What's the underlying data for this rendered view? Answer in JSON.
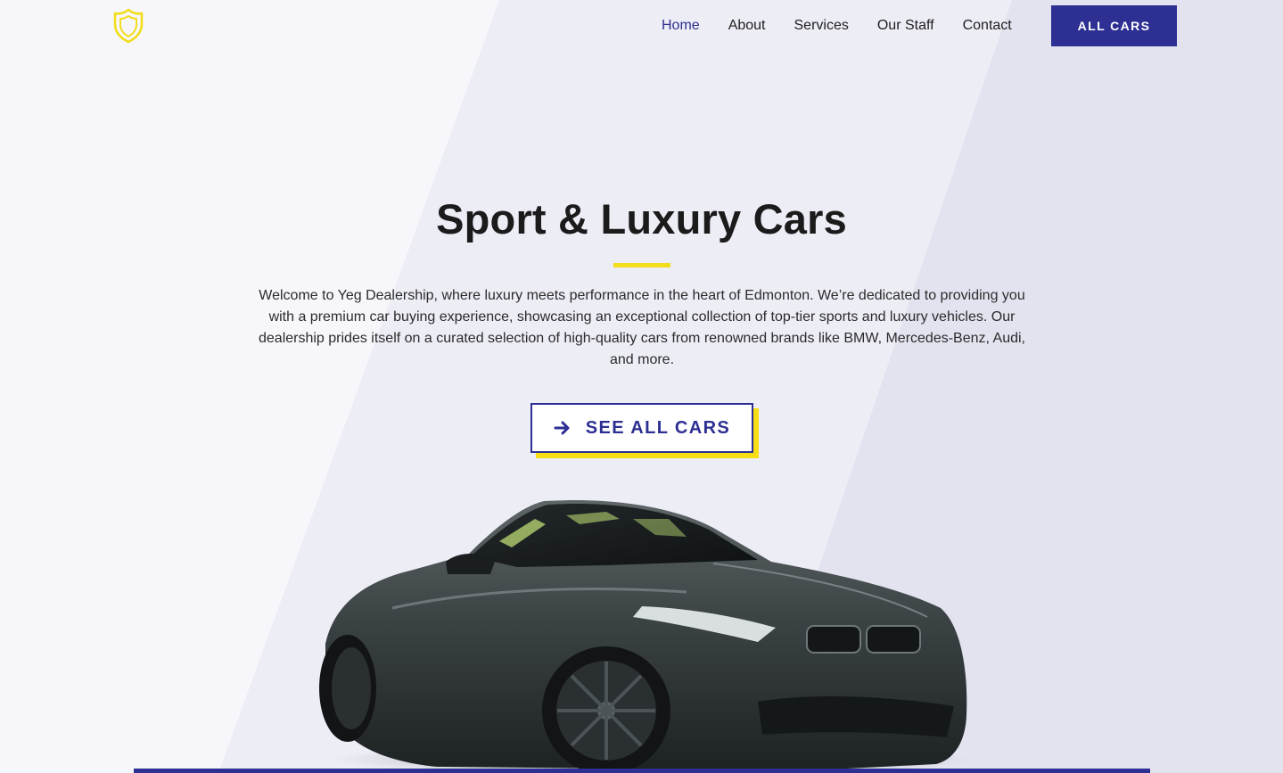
{
  "brand": {
    "logo_icon": "shield-icon",
    "accent": "#2d2f93",
    "highlight": "#f2dd1a"
  },
  "nav": {
    "items": [
      {
        "label": "Home",
        "active": true
      },
      {
        "label": "About",
        "active": false
      },
      {
        "label": "Services",
        "active": false
      },
      {
        "label": "Our Staff",
        "active": false
      },
      {
        "label": "Contact",
        "active": false
      }
    ],
    "cta_label": "ALL CARS"
  },
  "hero": {
    "title": "Sport & Luxury Cars",
    "description": "Welcome to Yeg Dealership, where luxury meets performance in the heart of Edmonton. We’re dedicated to providing you with a premium car buying experience, showcasing an exceptional collection of top-tier sports and luxury vehicles. Our dealership prides itself on a curated selection of high-quality cars from renowned brands like BMW, Mercedes-Benz, Audi, and more.",
    "cta_label": "SEE ALL CARS",
    "cta_icon": "arrow-right-icon",
    "image": "sports-car-image"
  }
}
